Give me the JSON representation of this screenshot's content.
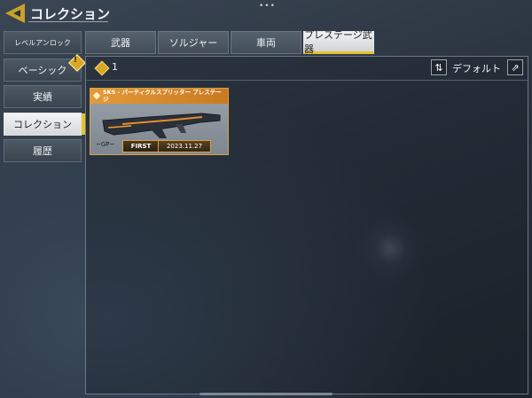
{
  "header": {
    "title": "コレクション",
    "handle": "•••"
  },
  "sidebar": {
    "items": [
      {
        "label": "レベルアンロック"
      },
      {
        "label": "ベーシック",
        "badge": "!"
      },
      {
        "label": "実績"
      },
      {
        "label": "コレクション",
        "active": true
      },
      {
        "label": "履歴"
      }
    ]
  },
  "tabs": [
    {
      "label": "武器"
    },
    {
      "label": "ソルジャー"
    },
    {
      "label": "車両"
    },
    {
      "label": "プレステージ武器",
      "selected": true
    }
  ],
  "toolbar": {
    "count": "1",
    "sort_label": "デフォルト",
    "sort_icon": "⇅",
    "export_icon": "⇗"
  },
  "card": {
    "title": "SKS - パーティクルスプリッター プレステージ",
    "first_label": "FIRST",
    "date": "2023.11.27",
    "gun_mark": "~GP~"
  },
  "colors": {
    "accent": "#e8c42a",
    "card_header": "#e49a3a"
  }
}
